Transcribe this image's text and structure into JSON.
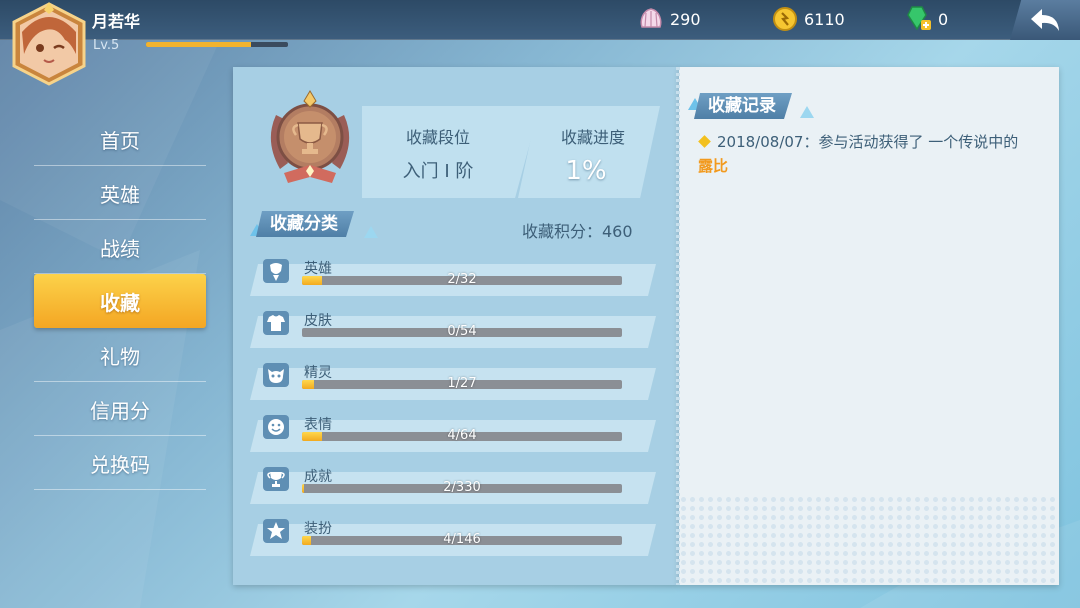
{
  "player": {
    "name": "月若华",
    "level": "Lv.5",
    "exp_progress": 0.74
  },
  "resources": {
    "shell": "290",
    "coin": "6110",
    "gem": "0"
  },
  "menu": {
    "items": [
      {
        "label": "首页"
      },
      {
        "label": "英雄"
      },
      {
        "label": "战绩"
      },
      {
        "label": "收藏"
      },
      {
        "label": "礼物"
      },
      {
        "label": "信用分"
      },
      {
        "label": "兑换码"
      }
    ],
    "active_index": 3
  },
  "rank": {
    "title": "收藏段位",
    "value": "入门 I 阶"
  },
  "progress": {
    "title": "收藏进度",
    "value": "1%"
  },
  "category": {
    "title": "收藏分类",
    "score": "收藏积分：460",
    "items": [
      {
        "name": "英雄",
        "count": "2/32",
        "icon": "hero-icon",
        "fraction": 0.0625
      },
      {
        "name": "皮肤",
        "count": "0/54",
        "icon": "skin-icon",
        "fraction": 0
      },
      {
        "name": "精灵",
        "count": "1/27",
        "icon": "sprite-icon",
        "fraction": 0.037
      },
      {
        "name": "表情",
        "count": "4/64",
        "icon": "emote-icon",
        "fraction": 0.0625
      },
      {
        "name": "成就",
        "count": "2/330",
        "icon": "trophy-icon",
        "fraction": 0.006
      },
      {
        "name": "装扮",
        "count": "4/146",
        "icon": "star-icon",
        "fraction": 0.027
      }
    ]
  },
  "log": {
    "title": "收藏记录",
    "entries": [
      {
        "prefix": "2018/08/07：参与活动获得了 一个传说中的",
        "highlight": "露比"
      }
    ]
  },
  "colors": {
    "accent": "#f4a623",
    "highlight": "#f29a1e"
  }
}
